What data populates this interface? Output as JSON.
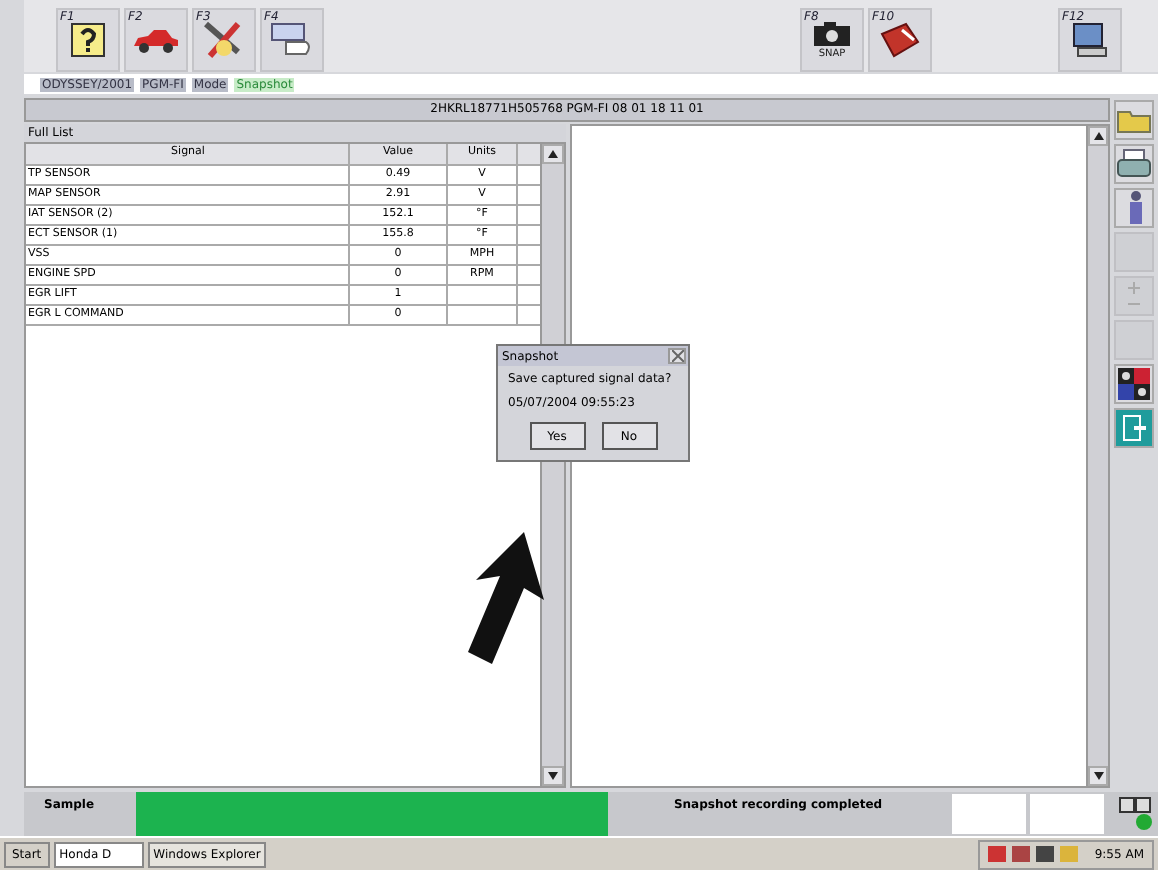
{
  "toolbar": {
    "keys": [
      {
        "label": "F1",
        "kind": "help"
      },
      {
        "label": "F2",
        "kind": "car"
      },
      {
        "label": "F3",
        "kind": "tools"
      },
      {
        "label": "F4",
        "kind": "hand"
      },
      {
        "label": "F8",
        "kind": "camera",
        "caption": "SNAP"
      },
      {
        "label": "F10",
        "kind": "book"
      },
      {
        "label": "F12",
        "kind": "computer"
      }
    ]
  },
  "breadcrumb": [
    {
      "label": "ODYSSEY/2001",
      "selected": false
    },
    {
      "label": "PGM-FI",
      "selected": false
    },
    {
      "label": "Mode",
      "selected": false
    },
    {
      "label": "Snapshot",
      "selected": true
    }
  ],
  "header": "2HKRL18771H505768  PGM-FI  08 01 18 11 01",
  "list": {
    "title": "Full List",
    "columns": [
      "Signal",
      "Value",
      "Units"
    ],
    "rows": [
      {
        "signal": "TP SENSOR",
        "value": "0.49",
        "units": "V"
      },
      {
        "signal": "MAP SENSOR",
        "value": "2.91",
        "units": "V"
      },
      {
        "signal": "IAT SENSOR (2)",
        "value": "152.1",
        "units": "°F"
      },
      {
        "signal": "ECT SENSOR (1)",
        "value": "155.8",
        "units": "°F"
      },
      {
        "signal": "VSS",
        "value": "0",
        "units": "MPH"
      },
      {
        "signal": "ENGINE SPD",
        "value": "0",
        "units": "RPM"
      },
      {
        "signal": "EGR LIFT",
        "value": "1"
      },
      {
        "signal": "EGR L COMMAND",
        "value": "0"
      }
    ]
  },
  "dialog": {
    "title": "Snapshot",
    "message": "Save captured signal data?",
    "timestamp": "05/07/2004  09:55:23",
    "buttons": [
      "Yes",
      "No"
    ]
  },
  "side_tools": [
    {
      "kind": "folder",
      "disabled": false
    },
    {
      "kind": "printer",
      "disabled": false
    },
    {
      "kind": "person",
      "disabled": false
    },
    {
      "kind": "blank",
      "disabled": true
    },
    {
      "kind": "plusminus",
      "disabled": true
    },
    {
      "kind": "blank",
      "disabled": true
    },
    {
      "kind": "grid",
      "disabled": false
    },
    {
      "kind": "exit",
      "disabled": false
    }
  ],
  "status": {
    "label": "Sample",
    "message": "Snapshot recording completed"
  },
  "taskbar": {
    "start": "Start",
    "tasks": [
      "Honda D",
      "Windows Explorer"
    ],
    "clock": "9:55 AM"
  }
}
